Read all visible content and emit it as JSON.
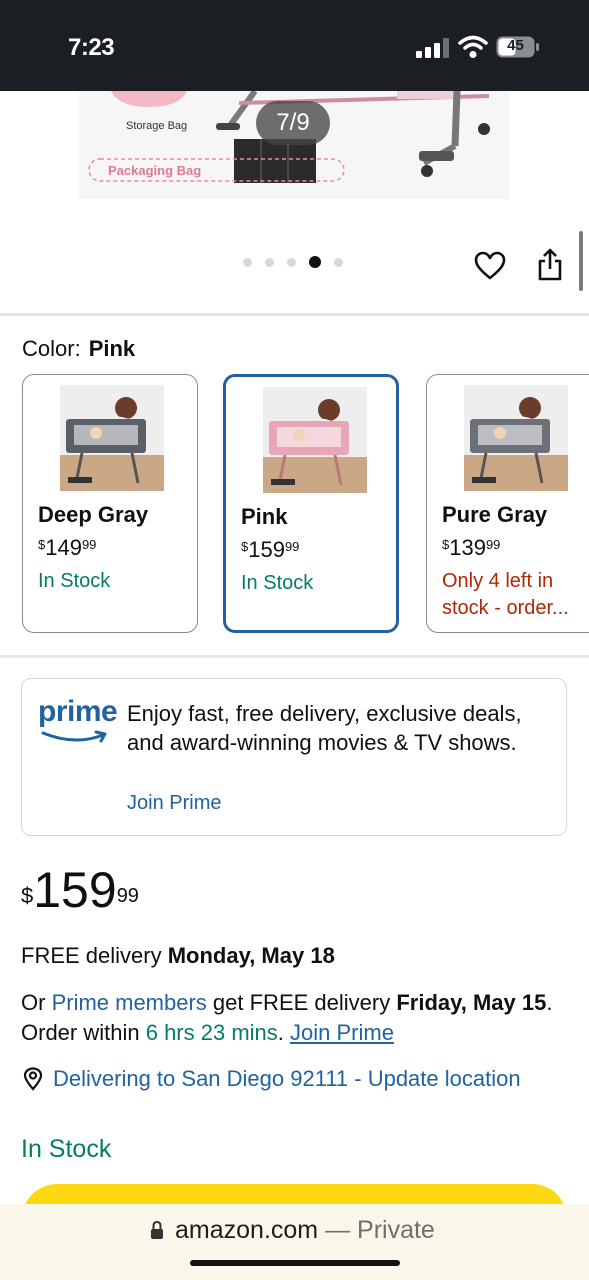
{
  "status_bar": {
    "time": "7:23",
    "battery": "45"
  },
  "gallery": {
    "image_labels": {
      "storage": "Storage Bag",
      "packaging": "Packaging Bag"
    },
    "counter": "7/9",
    "dots_total": 5,
    "dot_active_index": 3,
    "icons": [
      "heart-icon",
      "share-icon"
    ]
  },
  "color": {
    "label": "Color:",
    "selected": "Pink",
    "swatches": [
      {
        "name": "Deep Gray",
        "price_symbol": "$",
        "price_whole": "149",
        "price_fraction": "99",
        "stock": "In Stock",
        "crib_color": "#5b6068"
      },
      {
        "name": "Pink",
        "price_symbol": "$",
        "price_whole": "159",
        "price_fraction": "99",
        "stock": "In Stock",
        "crib_color": "#e8a7b6"
      },
      {
        "name": "Pure Gray",
        "price_symbol": "$",
        "price_whole": "139",
        "price_fraction": "99",
        "stock": "Only 4 left in stock - order...",
        "crib_color": "#6b7079"
      }
    ]
  },
  "prime": {
    "logo": "prime",
    "text": "Enjoy fast, free delivery, exclusive deals, and award-winning movies & TV shows.",
    "join": "Join Prime"
  },
  "price": {
    "symbol": "$",
    "whole": "159",
    "fraction": "99"
  },
  "delivery": {
    "prefix": "FREE delivery ",
    "date": "Monday, May 18"
  },
  "prime_delivery": {
    "or": "Or ",
    "members": "Prime members",
    "get": " get FREE delivery ",
    "date": "Friday, May 15",
    "order_within": ". Order within ",
    "countdown": "6 hrs 23 mins",
    "period": ". ",
    "join": "Join Prime"
  },
  "location": "Delivering to San Diego 92111 - Update location",
  "in_stock": "In Stock",
  "browser": {
    "domain": "amazon.com",
    "separator": " — ",
    "mode": "Private"
  },
  "colors": {
    "link": "#2162a1",
    "green": "#067d62",
    "alert": "#b12704",
    "selected_border": "#2162a1",
    "buy_button": "#ffd814"
  }
}
